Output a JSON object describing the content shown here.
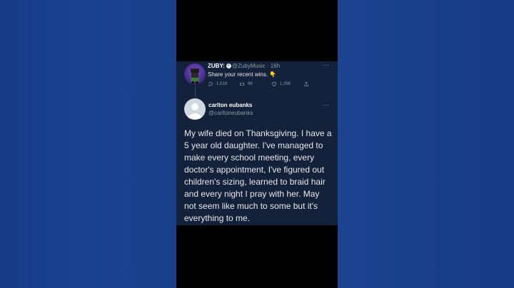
{
  "tweet1": {
    "name": "ZUBY:",
    "handle": "@ZubyMusic",
    "separator": "·",
    "time": "16h",
    "text": "Share your recent wins. 👇",
    "more_icon": "more-horizontal-icon",
    "replies": "1,019",
    "retweets": "96",
    "likes": "1,396",
    "icons": {
      "reply": "reply-icon",
      "retweet": "retweet-icon",
      "like": "heart-icon",
      "share": "share-icon"
    }
  },
  "tweet2": {
    "name": "carlton eubanks",
    "handle": "@carltoneubanks",
    "more_icon": "more-horizontal-icon",
    "lines": [
      "My wife died on Thanksgiving. I have a",
      "5 year old daughter. I've managed to",
      "make every school meeting, every",
      "doctor's appointment, I've figured out",
      "children's sizing, learned to braid hair",
      "and every night I pray with her. May",
      "not seem like much to some but it's",
      "everything to me."
    ]
  },
  "colors": {
    "background": "#1b4290",
    "video": "#000000",
    "card": "#14213a",
    "text": "#e7e9ea",
    "muted": "#8b98a5"
  }
}
